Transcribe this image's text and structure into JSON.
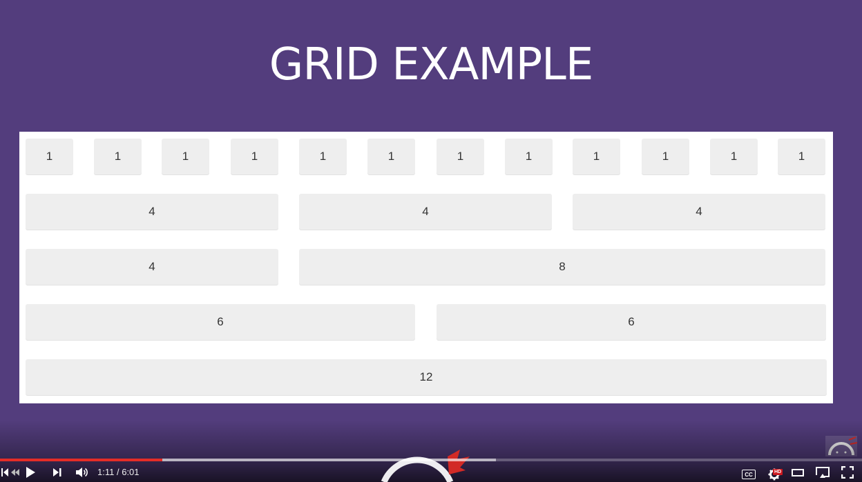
{
  "slide": {
    "title": "GRID EXAMPLE"
  },
  "grid": {
    "rows": [
      [
        "1",
        "1",
        "1",
        "1",
        "1",
        "1",
        "1",
        "1",
        "1",
        "1",
        "1",
        "1"
      ],
      [
        "4",
        "4",
        "4"
      ],
      [
        "4",
        "8"
      ],
      [
        "6",
        "6"
      ],
      [
        "12"
      ]
    ]
  },
  "player": {
    "progress_fraction": 0.188,
    "buffered_fraction": 0.575,
    "current_time": "1:11",
    "separator": "/",
    "duration": "6:01",
    "cc_label": "CC",
    "hd_label": "HD"
  },
  "colors": {
    "background": "#533d7d",
    "panel": "#ffffff",
    "cell": "#eeeeee",
    "progress": "#e52d27"
  }
}
